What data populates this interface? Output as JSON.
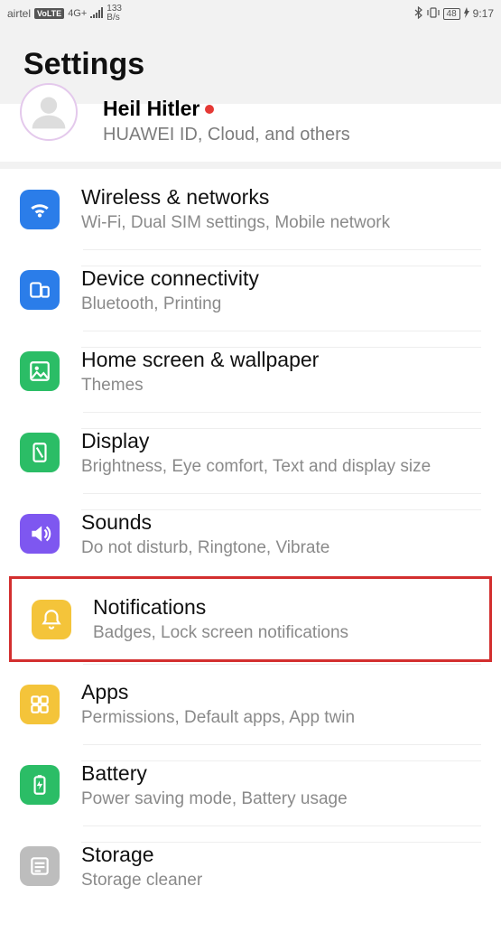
{
  "status": {
    "carrier": "airtel",
    "volte": "VoLTE",
    "net": "4G+",
    "bps_top": "133",
    "bps_bot": "B/s",
    "battery": "48",
    "time": "9:17"
  },
  "header": {
    "title": "Settings"
  },
  "account": {
    "name": "Heil Hitler",
    "sub": "HUAWEI ID, Cloud, and others"
  },
  "items": [
    {
      "icon": "wifi-icon",
      "color": "ic-blue",
      "title": "Wireless & networks",
      "sub": "Wi-Fi, Dual SIM settings, Mobile network"
    },
    {
      "icon": "connect-icon",
      "color": "ic-blue",
      "title": "Device connectivity",
      "sub": "Bluetooth, Printing"
    },
    {
      "icon": "picture-icon",
      "color": "ic-green",
      "title": "Home screen & wallpaper",
      "sub": "Themes"
    },
    {
      "icon": "display-icon",
      "color": "ic-green",
      "title": "Display",
      "sub": "Brightness, Eye comfort, Text and display size"
    },
    {
      "icon": "sound-icon",
      "color": "ic-purple",
      "title": "Sounds",
      "sub": "Do not disturb, Ringtone, Vibrate"
    },
    {
      "icon": "bell-icon",
      "color": "ic-yellow",
      "title": "Notifications",
      "sub": "Badges, Lock screen notifications",
      "highlight": true
    },
    {
      "icon": "apps-icon",
      "color": "ic-yellow",
      "title": "Apps",
      "sub": "Permissions, Default apps, App twin"
    },
    {
      "icon": "battery-icon",
      "color": "ic-green",
      "title": "Battery",
      "sub": "Power saving mode, Battery usage"
    },
    {
      "icon": "storage-icon",
      "color": "ic-gray",
      "title": "Storage",
      "sub": "Storage cleaner"
    }
  ]
}
